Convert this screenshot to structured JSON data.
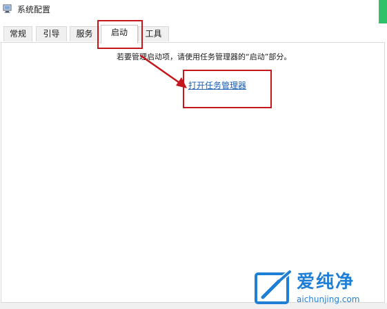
{
  "window": {
    "title": "系统配置",
    "icon": "system-config-icon"
  },
  "tabs": [
    {
      "label": "常规",
      "active": false
    },
    {
      "label": "引导",
      "active": false
    },
    {
      "label": "服务",
      "active": false
    },
    {
      "label": "启动",
      "active": true
    },
    {
      "label": "工具",
      "active": false
    }
  ],
  "startup": {
    "instruction": "若要管理启动项，请使用任务管理器的“启动”部分。",
    "link_label": "打开任务管理器"
  },
  "annotation": {
    "color": "#c4161c"
  },
  "watermark": {
    "name": "爱纯净",
    "url": "aichunjing.com",
    "color": "#1f7fd6"
  },
  "colors": {
    "accent": "#2ec16a",
    "link": "#1a5fb4"
  }
}
